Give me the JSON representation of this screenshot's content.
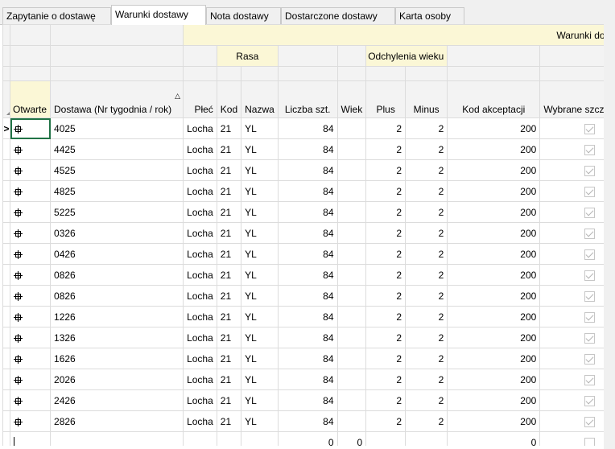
{
  "tabs": [
    {
      "label": "Zapytanie o dostawę",
      "active": false
    },
    {
      "label": "Warunki dostawy",
      "active": true
    },
    {
      "label": "Nota dostawy",
      "active": false
    },
    {
      "label": "Dostarczone dostawy",
      "active": false
    },
    {
      "label": "Karta osoby",
      "active": false
    }
  ],
  "groups": {
    "top": "Warunki dostawy",
    "rasa": "Rasa",
    "odchylenia": "Odchylenia wieku"
  },
  "columns": {
    "otwarte": "Otwarte",
    "dostawa": "Dostawa (Nr tygodnia / rok)",
    "plec": "Płeć",
    "kod": "Kod",
    "nazwa": "Nazwa",
    "liczba": "Liczba szt.",
    "wiek": "Wiek",
    "plus": "Plus",
    "minus": "Minus",
    "kod_akceptacji": "Kod akceptacji",
    "wybrane": "Wybrane szczepienia"
  },
  "rows": [
    {
      "dostawa": "4025",
      "plec": "Locha",
      "kod": "21",
      "nazwa": "YL",
      "liczba": "84",
      "wiek": "",
      "plus": "2",
      "minus": "2",
      "kod_akc": "200"
    },
    {
      "dostawa": "4425",
      "plec": "Locha",
      "kod": "21",
      "nazwa": "YL",
      "liczba": "84",
      "wiek": "",
      "plus": "2",
      "minus": "2",
      "kod_akc": "200"
    },
    {
      "dostawa": "4525",
      "plec": "Locha",
      "kod": "21",
      "nazwa": "YL",
      "liczba": "84",
      "wiek": "",
      "plus": "2",
      "minus": "2",
      "kod_akc": "200"
    },
    {
      "dostawa": "4825",
      "plec": "Locha",
      "kod": "21",
      "nazwa": "YL",
      "liczba": "84",
      "wiek": "",
      "plus": "2",
      "minus": "2",
      "kod_akc": "200"
    },
    {
      "dostawa": "5225",
      "plec": "Locha",
      "kod": "21",
      "nazwa": "YL",
      "liczba": "84",
      "wiek": "",
      "plus": "2",
      "minus": "2",
      "kod_akc": "200"
    },
    {
      "dostawa": "0326",
      "plec": "Locha",
      "kod": "21",
      "nazwa": "YL",
      "liczba": "84",
      "wiek": "",
      "plus": "2",
      "minus": "2",
      "kod_akc": "200"
    },
    {
      "dostawa": "0426",
      "plec": "Locha",
      "kod": "21",
      "nazwa": "YL",
      "liczba": "84",
      "wiek": "",
      "plus": "2",
      "minus": "2",
      "kod_akc": "200"
    },
    {
      "dostawa": "0826",
      "plec": "Locha",
      "kod": "21",
      "nazwa": "YL",
      "liczba": "84",
      "wiek": "",
      "plus": "2",
      "minus": "2",
      "kod_akc": "200"
    },
    {
      "dostawa": "0826",
      "plec": "Locha",
      "kod": "21",
      "nazwa": "YL",
      "liczba": "84",
      "wiek": "",
      "plus": "2",
      "minus": "2",
      "kod_akc": "200"
    },
    {
      "dostawa": "1226",
      "plec": "Locha",
      "kod": "21",
      "nazwa": "YL",
      "liczba": "84",
      "wiek": "",
      "plus": "2",
      "minus": "2",
      "kod_akc": "200"
    },
    {
      "dostawa": "1326",
      "plec": "Locha",
      "kod": "21",
      "nazwa": "YL",
      "liczba": "84",
      "wiek": "",
      "plus": "2",
      "minus": "2",
      "kod_akc": "200"
    },
    {
      "dostawa": "1626",
      "plec": "Locha",
      "kod": "21",
      "nazwa": "YL",
      "liczba": "84",
      "wiek": "",
      "plus": "2",
      "minus": "2",
      "kod_akc": "200"
    },
    {
      "dostawa": "2026",
      "plec": "Locha",
      "kod": "21",
      "nazwa": "YL",
      "liczba": "84",
      "wiek": "",
      "plus": "2",
      "minus": "2",
      "kod_akc": "200"
    },
    {
      "dostawa": "2426",
      "plec": "Locha",
      "kod": "21",
      "nazwa": "YL",
      "liczba": "84",
      "wiek": "",
      "plus": "2",
      "minus": "2",
      "kod_akc": "200"
    },
    {
      "dostawa": "2826",
      "plec": "Locha",
      "kod": "21",
      "nazwa": "YL",
      "liczba": "84",
      "wiek": "",
      "plus": "2",
      "minus": "2",
      "kod_akc": "200"
    }
  ],
  "totals": {
    "liczba": "0",
    "wiek": "0",
    "kod_akc": "0"
  },
  "current_row_marker": ">"
}
